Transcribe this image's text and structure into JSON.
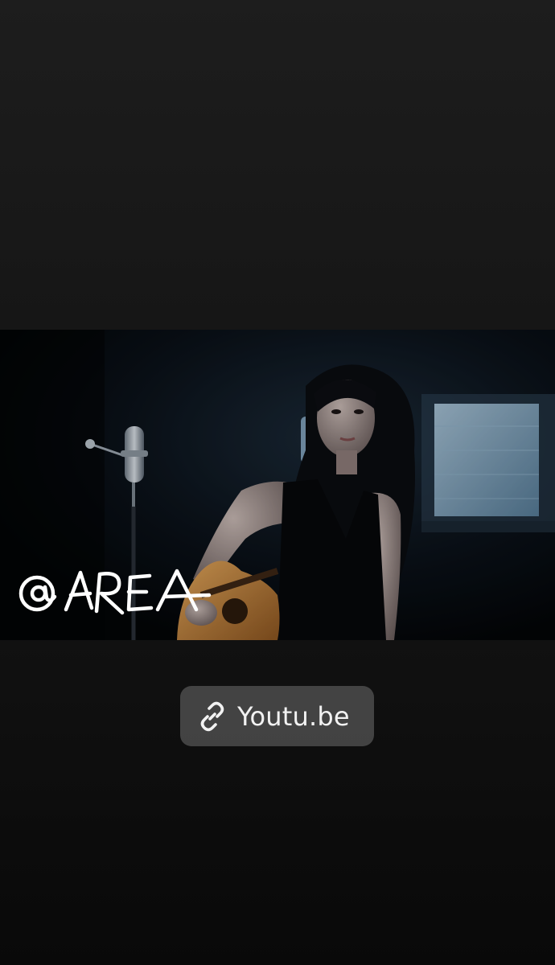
{
  "story": {
    "media": {
      "kind": "video-thumbnail",
      "watermark_text": "@AREA"
    },
    "link_sticker": {
      "icon": "link-icon",
      "label": "Youtu.be"
    }
  }
}
